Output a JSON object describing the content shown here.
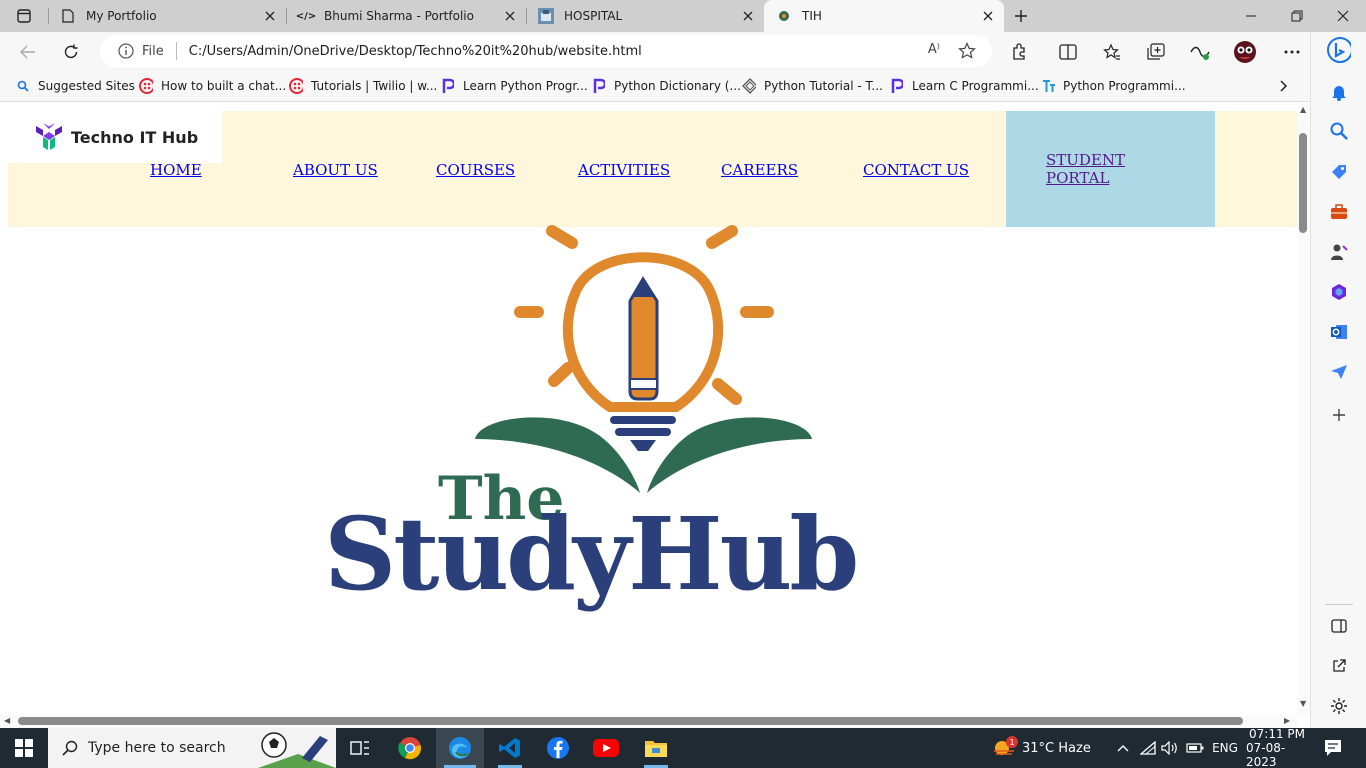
{
  "browser": {
    "tabs": [
      {
        "title": "My Portfolio",
        "icon": "page-icon",
        "active": false
      },
      {
        "title": "Bhumi Sharma - Portfolio",
        "icon": "code-icon",
        "active": false
      },
      {
        "title": "HOSPITAL",
        "icon": "image-icon",
        "active": false
      },
      {
        "title": "TIH",
        "icon": "tih-favicon",
        "active": true
      }
    ],
    "address": {
      "file_label": "File",
      "url": "C:/Users/Admin/OneDrive/Desktop/Techno%20it%20hub/website.html",
      "read_aloud": "A⁾"
    },
    "bookmarks": [
      {
        "label": "Suggested Sites",
        "icon": "search-icon",
        "color": "#1a73e8"
      },
      {
        "label": "How to built a chat...",
        "icon": "twilio-icon",
        "color": "#e22636"
      },
      {
        "label": "Tutorials | Twilio | w...",
        "icon": "twilio-icon",
        "color": "#e22636"
      },
      {
        "label": "Learn Python Progr...",
        "icon": "programiz-icon",
        "color": "#5b2ee8"
      },
      {
        "label": "Python Dictionary (...",
        "icon": "programiz-icon",
        "color": "#5b2ee8"
      },
      {
        "label": "Python Tutorial - T...",
        "icon": "diamond-icon",
        "color": "#555555"
      },
      {
        "label": "Learn C Programmi...",
        "icon": "programiz-icon",
        "color": "#5b2ee8"
      },
      {
        "label": "Python Programmi...",
        "icon": "tutorialspoint-icon",
        "color": "#1c9bd5"
      }
    ]
  },
  "site": {
    "logo_text": "Techno IT Hub",
    "nav": {
      "home": "HOME",
      "about": "ABOUT US",
      "courses": "COURSES",
      "activities": "ACTIVITIES",
      "careers": "CAREERS",
      "contact": "CONTACT US",
      "portal_line1": "STUDENT",
      "portal_line2": "PORTAL"
    },
    "hero": {
      "the": "The",
      "studyhub": "StudyHub",
      "colors": {
        "orange": "#e0892c",
        "green": "#2f6b52",
        "navy": "#2b3f7a"
      }
    },
    "colors": {
      "nav_bg": "#fef7dc",
      "portal_bg": "#add8e6",
      "link": "#0000ee",
      "visited": "#551a8b"
    }
  },
  "taskbar": {
    "search_placeholder": "Type here to search",
    "weather": "31°C  Haze",
    "weather_badge": "1",
    "language": "ENG",
    "time": "07:11 PM",
    "date": "07-08-2023"
  }
}
